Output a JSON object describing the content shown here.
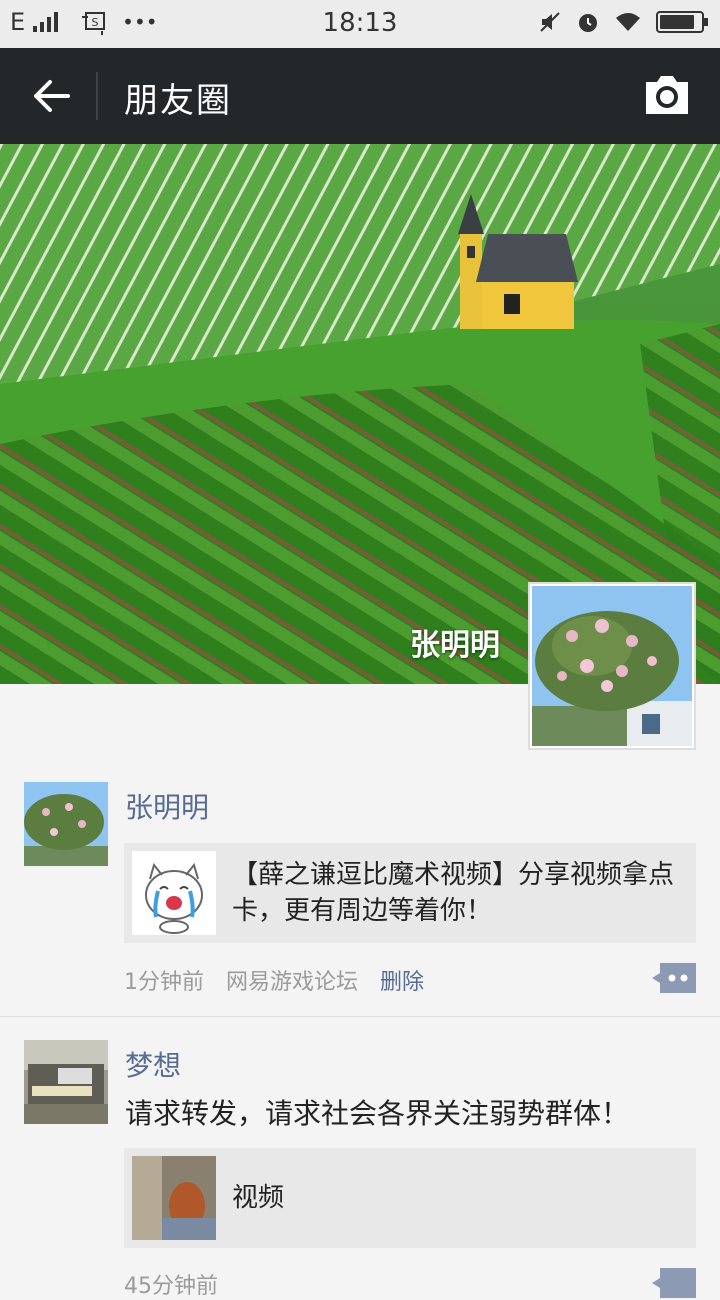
{
  "status": {
    "network": "E",
    "time": "18:13",
    "dots": "•••",
    "battery": 0.85
  },
  "header": {
    "title": "朋友圈"
  },
  "profile": {
    "name": "张明明"
  },
  "posts": [
    {
      "name": "张明明",
      "link_text": "【薛之谦逗比魔术视频】分享视频拿点卡，更有周边等着你！",
      "time": "1分钟前",
      "source": "网易游戏论坛",
      "delete": "删除"
    },
    {
      "name": "梦想",
      "text": "请求转发，请求社会各界关注弱势群体！",
      "link_text": "视频",
      "time": "45分钟前"
    }
  ],
  "colors": {
    "topbar": "#23272a",
    "link_name": "#576b95",
    "meta": "#9b9b9b"
  }
}
